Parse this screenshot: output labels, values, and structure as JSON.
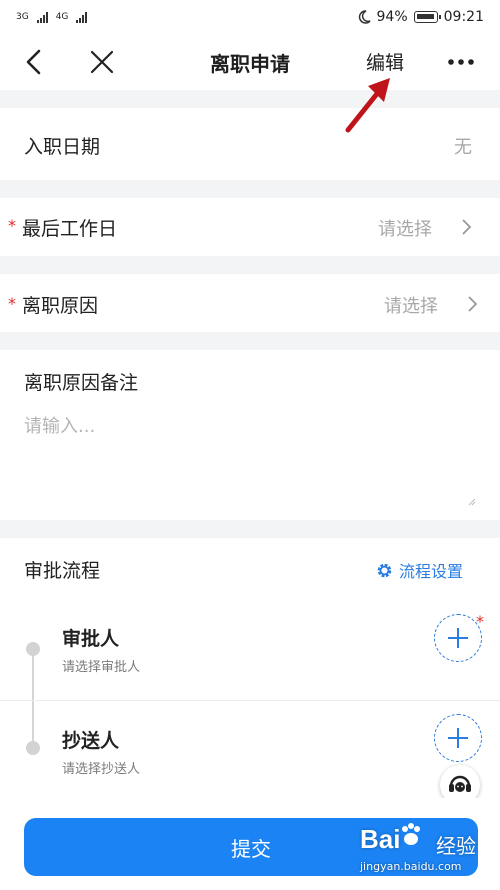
{
  "status_bar": {
    "sim1": "3G",
    "sim2": "4G",
    "battery": "94%",
    "time": "09:21"
  },
  "nav": {
    "title": "离职申请",
    "edit": "编辑"
  },
  "form": {
    "entry_date": {
      "label": "入职日期",
      "value": "无"
    },
    "last_work_day": {
      "required_mark": "*",
      "label": "最后工作日",
      "value": "请选择"
    },
    "reason": {
      "required_mark": "*",
      "label": "离职原因",
      "value": "请选择"
    },
    "remark": {
      "label": "离职原因备注",
      "placeholder": "请输入..."
    }
  },
  "approval": {
    "title": "审批流程",
    "settings": "流程设置",
    "approver": {
      "title": "审批人",
      "hint": "请选择审批人",
      "required_mark": "*"
    },
    "cc": {
      "title": "抄送人",
      "hint": "请选择抄送人"
    }
  },
  "submit_label": "提交",
  "watermark": {
    "brand": "Bai",
    "brand2": "经验",
    "url": "jingyan.baidu.com"
  },
  "colors": {
    "accent": "#1b83f3",
    "required": "#e02b2b",
    "annotation_arrow": "#c0141b"
  },
  "icons": [
    "back-arrow-icon",
    "close-icon",
    "more-icon",
    "gear-icon",
    "plus-icon",
    "customer-service-icon",
    "chevron-right-icon"
  ]
}
